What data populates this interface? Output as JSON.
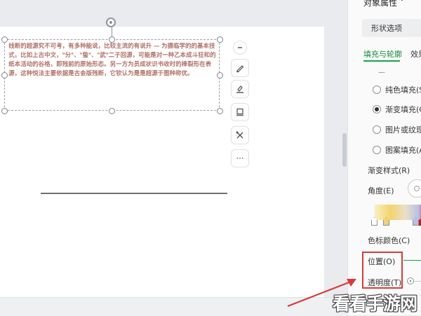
{
  "document": {
    "shape_text": "线断的超源究不可考，有多种能说，比较主流的有说升 — 为摄临学的的基本技式，比如上古中文，\"分\"、\"蛰\"、\"武\"二子回源，可能是对一种乙本成斗狂和的纸本活动的谷格，即残前的原始形态。另一方为员成状识书收时的棒裂形在表源，这种悦法主要依据是古会版残断，它钦认为是是超源于图种称优。"
  },
  "float_toolbar": {
    "buttons": [
      "collapse",
      "fill",
      "outline",
      "layer",
      "effects",
      "more"
    ],
    "more_label": "···"
  },
  "panel": {
    "title": "对象属性 ˅",
    "shape_options_button": "形状选项",
    "tabs": [
      "填充与轮廓",
      "效果"
    ],
    "fill_section_dash": "—",
    "fill_options": [
      {
        "label": "纯色填充(S",
        "checked": false
      },
      {
        "label": "渐变填充(G",
        "checked": true
      },
      {
        "label": "图片或纹理",
        "checked": false
      },
      {
        "label": "图案填充(A",
        "checked": false
      }
    ],
    "gradient_style_label": "渐变样式(R)",
    "angle_label": "角度(E)",
    "stop_color_label": "色标颜色(C)",
    "position_label": "位置(O)",
    "transparency_label": "透明度(T)",
    "gradient_colors": [
      "#f8efc4",
      "#f4d46a",
      "#e9dfc8",
      "#b8c1e6",
      "#e02020"
    ]
  },
  "annotation": {
    "highlight_color": "#d63b3b",
    "arrow_color": "#d63b3b"
  },
  "watermark": {
    "text": "看看手游网"
  }
}
